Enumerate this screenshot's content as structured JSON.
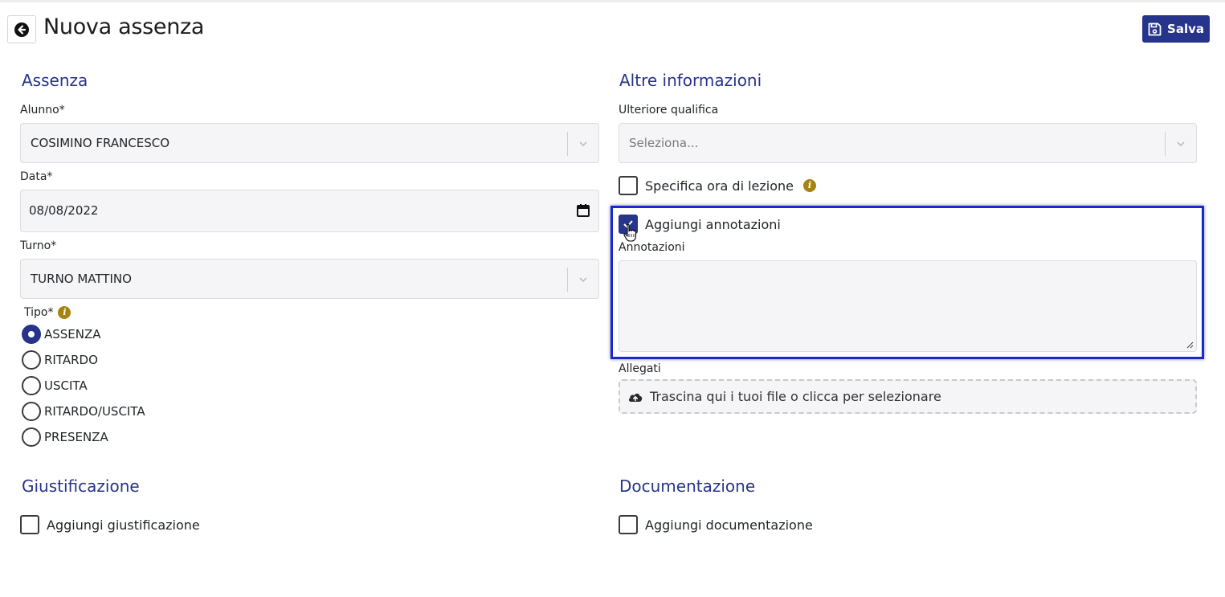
{
  "header": {
    "title": "Nuova assenza",
    "back_icon": "arrow-left-circle-icon",
    "save_label": "Salva",
    "save_icon": "floppy-disk-icon"
  },
  "assenza": {
    "section_title": "Assenza",
    "alunno_label": "Alunno*",
    "alunno_value": "COSIMINO FRANCESCO",
    "data_label": "Data*",
    "data_value": "08/08/2022",
    "turno_label": "Turno*",
    "turno_value": "TURNO MATTINO",
    "tipo_label": "Tipo*",
    "tipo_options": [
      {
        "label": "ASSENZA",
        "checked": true
      },
      {
        "label": "RITARDO",
        "checked": false
      },
      {
        "label": "USCITA",
        "checked": false
      },
      {
        "label": "RITARDO/USCITA",
        "checked": false
      },
      {
        "label": "PRESENZA",
        "checked": false
      }
    ]
  },
  "altre": {
    "section_title": "Altre informazioni",
    "qualifica_label": "Ulteriore qualifica",
    "qualifica_placeholder": "Seleziona...",
    "specifica_label": "Specifica ora di lezione",
    "specifica_checked": false,
    "annotazioni_check_label": "Aggiungi annotazioni",
    "annotazioni_checked": true,
    "annotazioni_label": "Annotazioni",
    "annotazioni_value": "",
    "allegati_label": "Allegati",
    "allegati_drop_text": "Trascina qui i tuoi file o clicca per selezionare",
    "allegati_icon": "cloud-upload-icon"
  },
  "giustificazione": {
    "section_title": "Giustificazione",
    "check_label": "Aggiungi giustificazione",
    "checked": false
  },
  "documentazione": {
    "section_title": "Documentazione",
    "check_label": "Aggiungi documentazione",
    "checked": false
  },
  "colors": {
    "primary": "#27348b",
    "info": "#a6840f",
    "highlight": "#1a28d0"
  }
}
